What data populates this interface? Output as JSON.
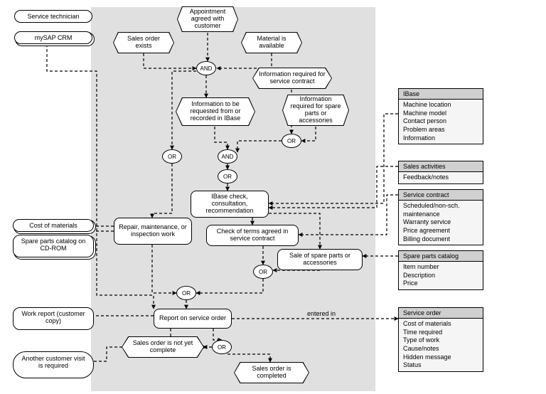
{
  "diagram": {
    "left": {
      "service_tech": "Service technician",
      "mysap": "mySAP CRM",
      "cost_materials": "Cost of materials",
      "spare_catalog_cd": "Spare parts catalog on CD-ROM",
      "work_report": "Work report (customer copy)",
      "another_visit": "Another customer visit is required"
    },
    "events": {
      "sales_order_exists": "Sales order exists",
      "appointment": "Appointment agreed with customer",
      "material_avail": "Material is available",
      "info_contract": "Information required for service contract",
      "info_ibase": "Information to be requested from or recorded in IBase",
      "info_spare": "Information required for spare parts or accessories",
      "not_complete": "Sales order is not yet complete",
      "completed": "Sales order is completed"
    },
    "functions": {
      "ibase_check": "IBase check, consultation, recommendation",
      "repair": "Repair, maintenance, or inspection work",
      "check_terms": "Check of terms agreed in service contract",
      "sale_spare": "Sale of spare parts or accessories",
      "report": "Report on service order"
    },
    "connectors": {
      "and": "AND",
      "or": "OR"
    },
    "freetext": {
      "entered_in": "entered in"
    },
    "sidebar": {
      "ibase": {
        "header": "IBase",
        "lines": [
          "Machine location",
          "Machine model",
          "Contact person",
          "Problem areas",
          "Information"
        ]
      },
      "sales_act": {
        "header": "Sales activities",
        "lines": [
          "Feedback/notes"
        ]
      },
      "service_contract": {
        "header": "Service contract",
        "lines": [
          "Scheduled/non-sch. maintenance",
          "Warranty service",
          "Price agreement",
          "Billing document"
        ]
      },
      "spare_catalog": {
        "header": "Spare parts catalog",
        "lines": [
          "Item number",
          "Description",
          "Price"
        ]
      },
      "service_order": {
        "header": "Service order",
        "lines": [
          "Cost of materials",
          "Time required",
          "Type of work",
          "Cause/notes",
          "Hidden message",
          "Status"
        ]
      }
    }
  }
}
